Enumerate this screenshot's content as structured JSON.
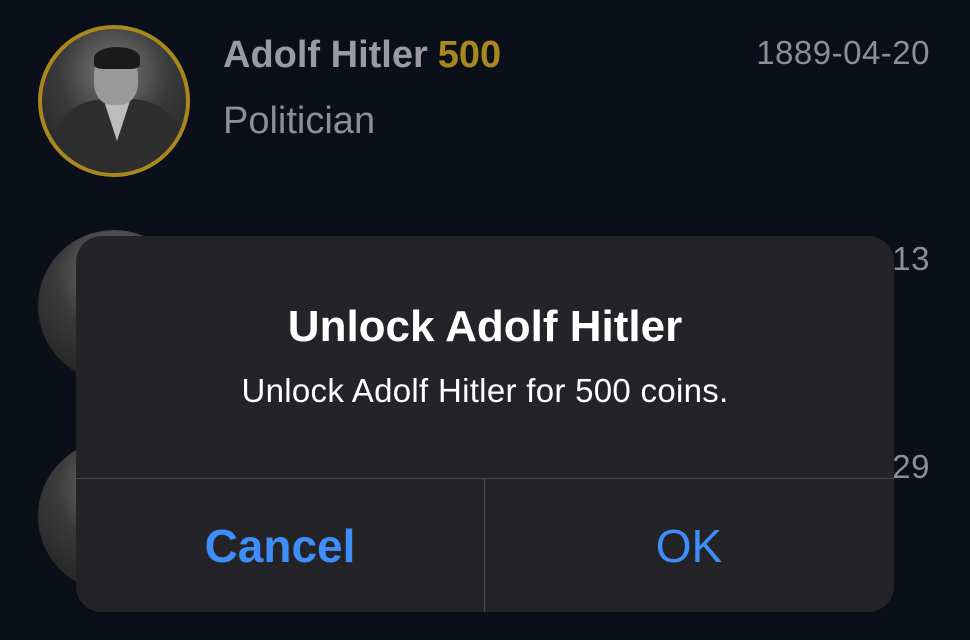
{
  "list": {
    "rows": [
      {
        "name": "Adolf Hitler",
        "price": "500",
        "occupation": "Politician",
        "date": "1889-04-20"
      },
      {
        "date_fragment": "13"
      },
      {
        "date_fragment": "29"
      }
    ]
  },
  "dialog": {
    "title": "Unlock Adolf Hitler",
    "message": "Unlock Adolf Hitler for 500 coins.",
    "cancel_label": "Cancel",
    "ok_label": "OK"
  },
  "colors": {
    "background": "#0b0f1a",
    "gold": "#a8871f",
    "dialog_bg": "#242428",
    "button_blue": "#3e8ef7"
  }
}
